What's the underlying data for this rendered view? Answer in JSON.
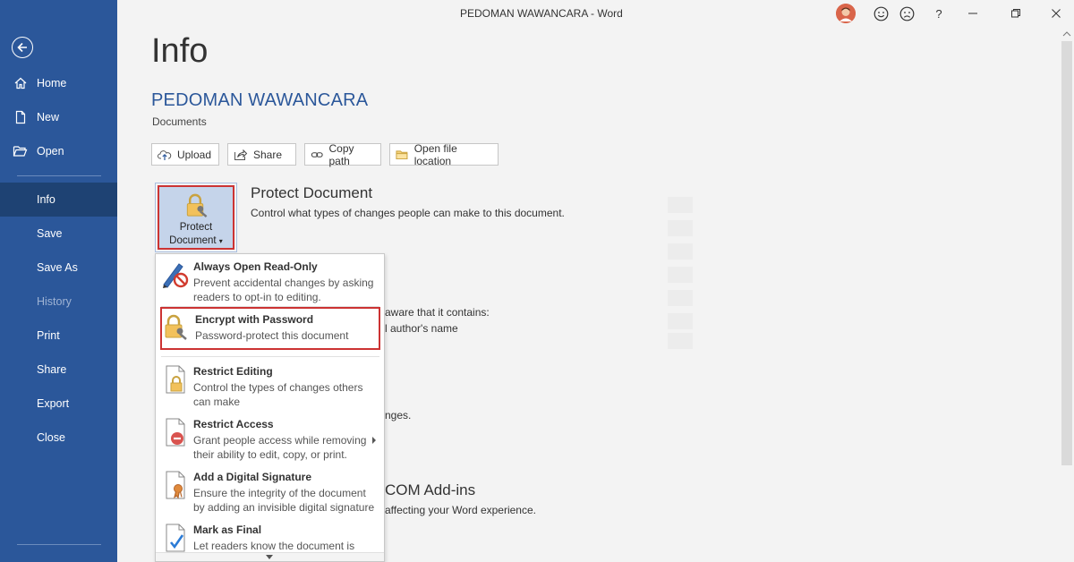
{
  "window": {
    "title": "PEDOMAN WAWANCARA  -  Word",
    "controls": {
      "help": "?"
    }
  },
  "sidebar": {
    "items": [
      {
        "label": "Home"
      },
      {
        "label": "New"
      },
      {
        "label": "Open"
      },
      {
        "label": "Info"
      },
      {
        "label": "Save"
      },
      {
        "label": "Save As"
      },
      {
        "label": "History"
      },
      {
        "label": "Print"
      },
      {
        "label": "Share"
      },
      {
        "label": "Export"
      },
      {
        "label": "Close"
      }
    ]
  },
  "main": {
    "heading": "Info",
    "document_title": "PEDOMAN WAWANCARA",
    "document_location": "Documents",
    "actions": [
      {
        "label": "Upload"
      },
      {
        "label": "Share"
      },
      {
        "label": "Copy path"
      },
      {
        "label": "Open file location"
      }
    ],
    "protect": {
      "tile_label_1": "Protect",
      "tile_label_2": "Document",
      "title": "Protect Document",
      "description": "Control what types of changes people can make to this document."
    },
    "partial_texts": {
      "aware": "aware that it contains:",
      "author": "l author's name",
      "changes": "nges.",
      "com_addins": "COM Add-ins",
      "affecting": "affecting your Word experience."
    }
  },
  "dropdown": {
    "items": [
      {
        "title": "Always Open Read-Only",
        "desc": "Prevent accidental changes by asking readers to opt-in to editing."
      },
      {
        "title": "Encrypt with Password",
        "desc": "Password-protect this document"
      },
      {
        "title": "Restrict Editing",
        "desc": "Control the types of changes others can make"
      },
      {
        "title": "Restrict Access",
        "desc": "Grant people access while removing their ability to edit, copy, or print."
      },
      {
        "title": "Add a Digital Signature",
        "desc": "Ensure the integrity of the document by adding an invisible digital signature"
      },
      {
        "title": "Mark as Final",
        "desc": "Let readers know the document is"
      }
    ]
  },
  "colors": {
    "sidebar": "#2b579a",
    "sidebar_active": "#1e4273",
    "highlight_border": "#cc3333",
    "title_blue": "#2b579a"
  }
}
